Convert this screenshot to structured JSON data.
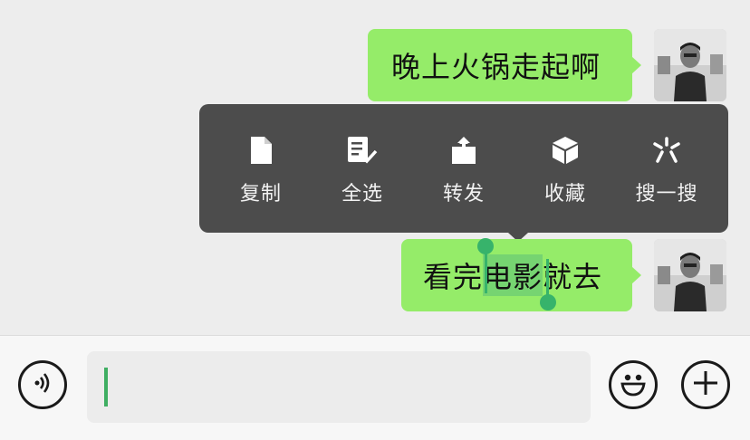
{
  "messages": [
    {
      "text": "晚上火锅走起啊"
    },
    {
      "text_before": "看完",
      "text_selected": "电影",
      "text_after": "就去"
    }
  ],
  "context_menu": {
    "items": [
      {
        "label": "复制",
        "icon": "file-icon"
      },
      {
        "label": "全选",
        "icon": "select-all-icon"
      },
      {
        "label": "转发",
        "icon": "share-icon"
      },
      {
        "label": "收藏",
        "icon": "cube-icon"
      },
      {
        "label": "搜一搜",
        "icon": "sparkle-search-icon"
      }
    ]
  },
  "input": {
    "value": ""
  },
  "colors": {
    "bubble": "#95ec69",
    "menu_bg": "#4c4c4c",
    "selection_handle": "#37b36b",
    "caret": "#3fae62"
  }
}
